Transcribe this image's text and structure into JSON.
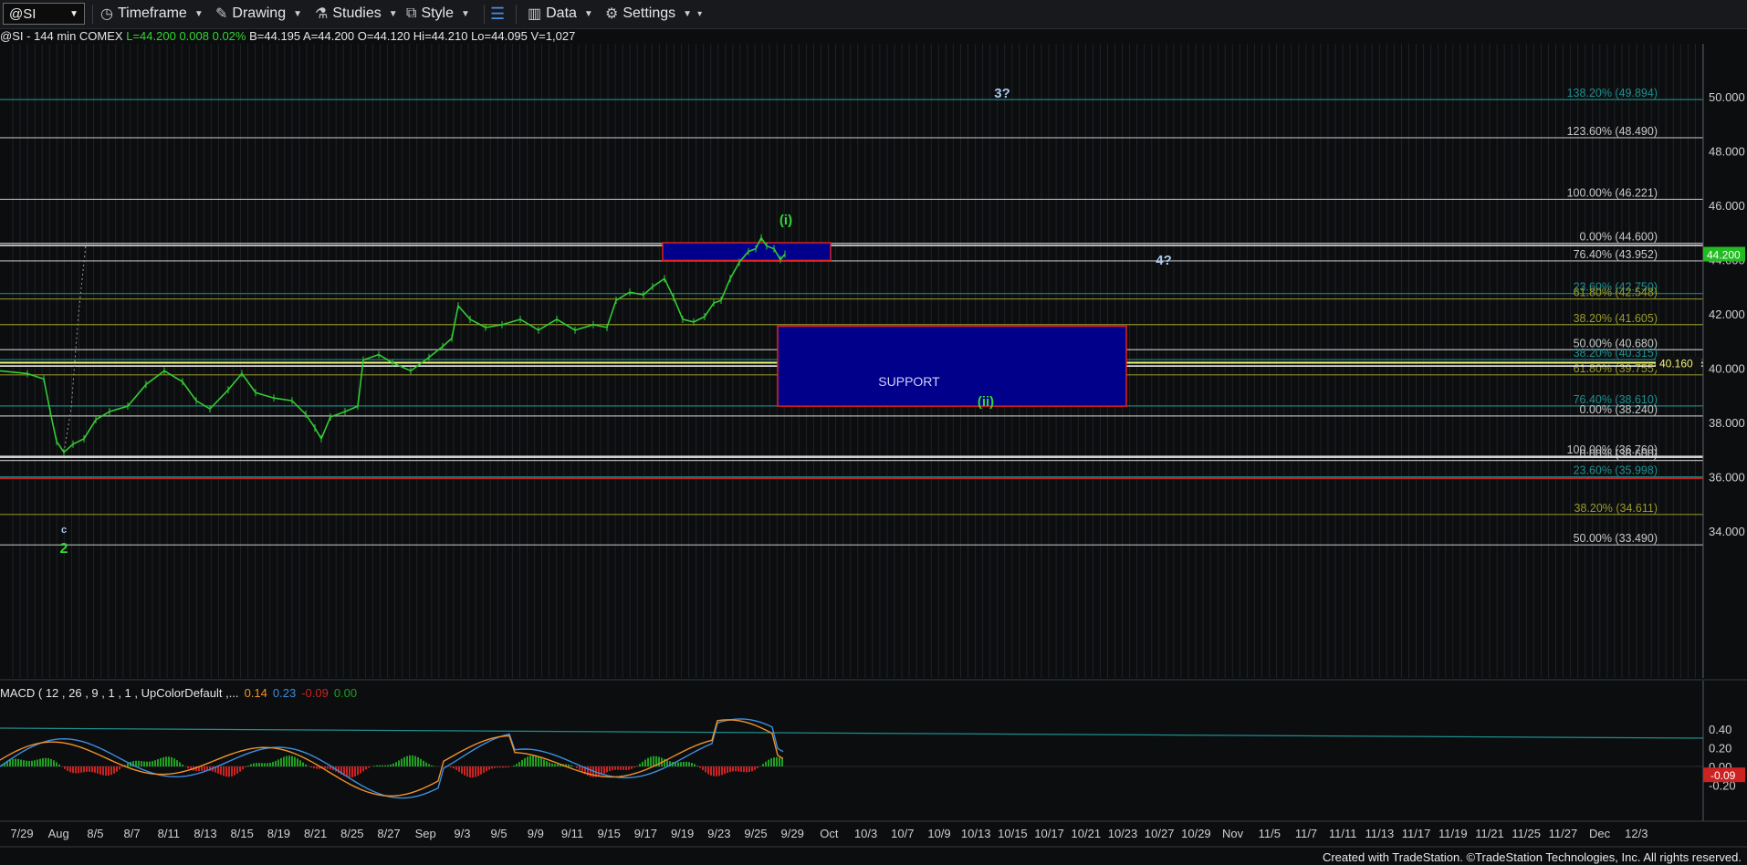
{
  "toolbar": {
    "symbol": "@SI",
    "timeframe": "Timeframe",
    "drawing": "Drawing",
    "studies": "Studies",
    "style": "Style",
    "data": "Data",
    "settings": "Settings"
  },
  "quote": {
    "symbol": "@SI",
    "interval": "144 min",
    "exchange": "COMEX",
    "last": "L=44.200",
    "change": "0.008",
    "pct": "0.02%",
    "bid": "B=44.195",
    "ask": "A=44.200",
    "open": "O=44.120",
    "high": "Hi=44.210",
    "low": "Lo=44.095",
    "volume": "V=1,027"
  },
  "price_axis": {
    "ticks": [
      "50.000",
      "48.000",
      "46.000",
      "44.000",
      "42.000",
      "40.000",
      "38.000",
      "36.000",
      "34.000"
    ],
    "last_price_tag": "44.200",
    "level_tag": "40.160"
  },
  "fib_levels": [
    {
      "label": "138.20% (49.894)",
      "price": 49.894,
      "color": "#1f8e8e"
    },
    {
      "label": "123.60% (48.490)",
      "price": 48.49,
      "color": "#c8c8c8"
    },
    {
      "label": "100.00% (46.221)",
      "price": 46.221,
      "color": "#c8c8c8"
    },
    {
      "label": "0.00% (44.600)",
      "price": 44.6,
      "color": "#c8c8c8"
    },
    {
      "label": "76.40% (43.952)",
      "price": 43.952,
      "color": "#c8c8c8"
    },
    {
      "label": "23.60% (42.750)",
      "price": 42.75,
      "color": "#1f8e8e"
    },
    {
      "label": "61.80% (42.548)",
      "price": 42.548,
      "color": "#9a9a2a"
    },
    {
      "label": "38.20% (41.605)",
      "price": 41.605,
      "color": "#9a9a2a"
    },
    {
      "label": "50.00% (40.680)",
      "price": 40.68,
      "color": "#c8c8c8"
    },
    {
      "label": "38.20% (40.315)",
      "price": 40.315,
      "color": "#1f8e8e"
    },
    {
      "label": "61.80% (39.755)",
      "price": 39.755,
      "color": "#9a9a2a"
    },
    {
      "label": "76.40% (38.610)",
      "price": 38.61,
      "color": "#1f8e8e"
    },
    {
      "label": "0.00% (38.240)",
      "price": 38.24,
      "color": "#c8c8c8"
    },
    {
      "label": "100.00% (36.760)",
      "price": 36.76,
      "color": "#c8c8c8"
    },
    {
      "label": "0.00% (36.600)",
      "price": 36.6,
      "color": "#c8c8c8"
    },
    {
      "label": "23.60% (35.998)",
      "price": 35.998,
      "color": "#1f8e8e"
    },
    {
      "label": "38.20% (34.611)",
      "price": 34.611,
      "color": "#9a9a2a"
    },
    {
      "label": "50.00% (33.490)",
      "price": 33.49,
      "color": "#c8c8c8"
    }
  ],
  "wave_labels": [
    {
      "text": "3?",
      "color": "#a9c7ea"
    },
    {
      "text": "4?",
      "color": "#a9c7ea"
    },
    {
      "text": "(i)",
      "color": "#33d633"
    },
    {
      "text": "(ii)",
      "color": "#33d633"
    },
    {
      "text": "c",
      "color": "#a9c7ea"
    },
    {
      "text": "2",
      "color": "#33d633"
    }
  ],
  "support_label": "SUPPORT",
  "macd": {
    "title": "MACD ( 12 , 26 , 9 , 1 , 1 , UpColorDefault ,...",
    "macd_value": "0.14",
    "signal_value": "0.23",
    "hist_value": "-0.09",
    "zero_value": "0.00",
    "axis_ticks": [
      "0.40",
      "0.20",
      "0.00",
      "-0.20"
    ],
    "last_tag": "-0.09"
  },
  "date_axis": [
    "7/29",
    "Aug",
    "8/5",
    "8/7",
    "8/11",
    "8/13",
    "8/15",
    "8/19",
    "8/21",
    "8/25",
    "8/27",
    "Sep",
    "9/3",
    "9/5",
    "9/9",
    "9/11",
    "9/15",
    "9/17",
    "9/19",
    "9/23",
    "9/25",
    "9/29",
    "Oct",
    "10/3",
    "10/7",
    "10/9",
    "10/13",
    "10/15",
    "10/17",
    "10/21",
    "10/23",
    "10/27",
    "10/29",
    "Nov",
    "11/5",
    "11/7",
    "11/11",
    "11/13",
    "11/17",
    "11/19",
    "11/21",
    "11/25",
    "11/27",
    "Dec",
    "12/3"
  ],
  "footer": "Created with TradeStation. ©TradeStation Technologies, Inc. All rights reserved.",
  "colors": {
    "price": "#33cc33",
    "macd_line": "#3d8ee0",
    "signal_line": "#f0922a",
    "hist_up": "#1fa01f",
    "hist_down": "#cc2222",
    "support_fill": "#00008a",
    "support_border": "#e02020"
  }
}
